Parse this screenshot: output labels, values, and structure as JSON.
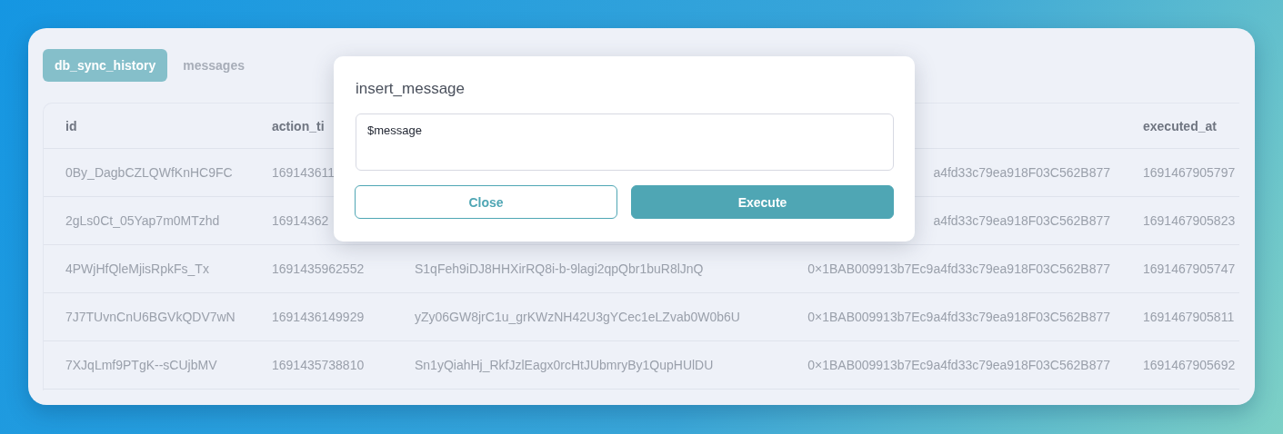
{
  "tabs": [
    {
      "label": "db_sync_history",
      "selected": true
    },
    {
      "label": "messages",
      "selected": false
    }
  ],
  "table": {
    "columns": {
      "id": "id",
      "action_time": "action_ti",
      "executed_at": "executed_at"
    },
    "rows": [
      {
        "id": "0By_DagbCZLQWfKnHC9FC",
        "action_time": "169143611",
        "column_4": "a4fd33c79ea918F03C562B877",
        "executed_at": "1691467905797"
      },
      {
        "id": "2gLs0Ct_05Yap7m0MTzhd",
        "action_time": "16914362",
        "column_4": "a4fd33c79ea918F03C562B877",
        "executed_at": "1691467905823"
      },
      {
        "id": "4PWjHfQleMjisRpkFs_Tx",
        "action_time": "1691435962552",
        "column_3": "S1qFeh9iDJ8HHXirRQ8i-b-9lagi2qpQbr1buR8lJnQ",
        "column_4": "0×1BAB009913b7Ec9a4fd33c79ea918F03C562B877",
        "executed_at": "1691467905747"
      },
      {
        "id": "7J7TUvnCnU6BGVkQDV7wN",
        "action_time": "1691436149929",
        "column_3": "yZy06GW8jrC1u_grKWzNH42U3gYCec1eLZvab0W0b6U",
        "column_4": "0×1BAB009913b7Ec9a4fd33c79ea918F03C562B877",
        "executed_at": "1691467905811"
      },
      {
        "id": "7XJqLmf9PTgK--sCUjbMV",
        "action_time": "1691435738810",
        "column_3": "Sn1yQiahHj_RkfJzlEagx0rcHtJUbmryBy1QupHUlDU",
        "column_4": "0×1BAB009913b7Ec9a4fd33c79ea918F03C562B877",
        "executed_at": "1691467905692"
      }
    ]
  },
  "modal": {
    "title": "insert_message",
    "field": {
      "value": "$message"
    },
    "buttons": [
      {
        "label": "Close",
        "kind": "secondary"
      },
      {
        "label": "Execute",
        "kind": "primary"
      }
    ]
  }
}
